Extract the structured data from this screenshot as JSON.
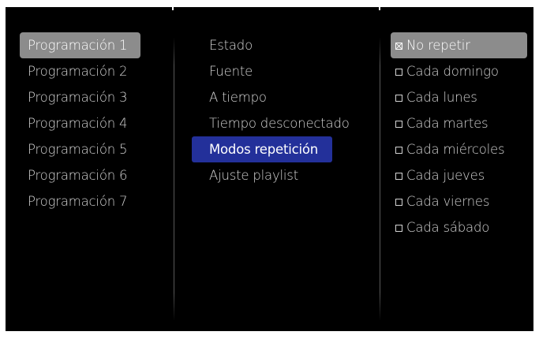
{
  "schedules": [
    {
      "label": "Programación 1",
      "selected": true
    },
    {
      "label": "Programación 2",
      "selected": false
    },
    {
      "label": "Programación 3",
      "selected": false
    },
    {
      "label": "Programación 4",
      "selected": false
    },
    {
      "label": "Programación 5",
      "selected": false
    },
    {
      "label": "Programación 6",
      "selected": false
    },
    {
      "label": "Programación 7",
      "selected": false
    }
  ],
  "settings": [
    {
      "label": "Estado",
      "selected": false
    },
    {
      "label": "Fuente",
      "selected": false
    },
    {
      "label": "A tiempo",
      "selected": false
    },
    {
      "label": "Tiempo desconectado",
      "selected": false
    },
    {
      "label": "Modos repetición",
      "selected": true
    },
    {
      "label": "Ajuste playlist",
      "selected": false
    }
  ],
  "repeat_options": [
    {
      "label": "No repetir",
      "checked": true,
      "selected": true
    },
    {
      "label": "Cada domingo",
      "checked": false,
      "selected": false
    },
    {
      "label": "Cada lunes",
      "checked": false,
      "selected": false
    },
    {
      "label": "Cada martes",
      "checked": false,
      "selected": false
    },
    {
      "label": "Cada miércoles",
      "checked": false,
      "selected": false
    },
    {
      "label": "Cada jueves",
      "checked": false,
      "selected": false
    },
    {
      "label": "Cada viernes",
      "checked": false,
      "selected": false
    },
    {
      "label": "Cada sábado",
      "checked": false,
      "selected": false
    }
  ],
  "colors": {
    "background": "#000000",
    "text": "#d4d4d4",
    "selected_gray": "#8c8c8c",
    "selected_blue": "#23309a"
  }
}
